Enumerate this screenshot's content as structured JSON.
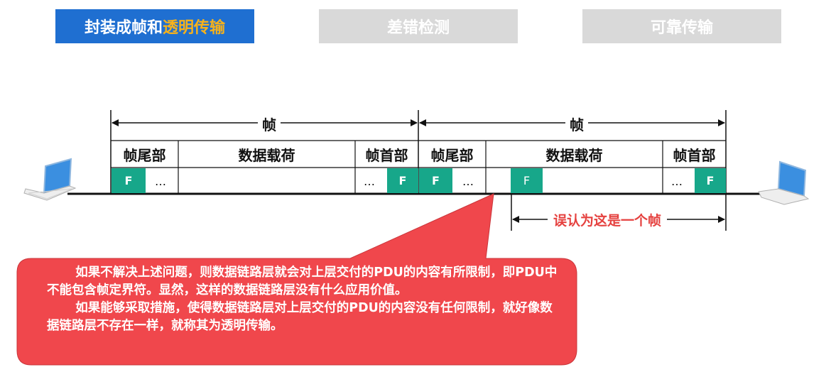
{
  "tabs": [
    {
      "label_a": "封装成帧和",
      "label_b": "透明传输",
      "active": true
    },
    {
      "label": "差错检测",
      "active": false
    },
    {
      "label": "可靠传输",
      "active": false
    }
  ],
  "diagram": {
    "frame_label": "帧",
    "header_label": "帧首部",
    "payload_label": "数据载荷",
    "trailer_label": "帧尾部",
    "flag": "F",
    "ellipsis": "…",
    "misread_label": "误认为这是一个帧"
  },
  "note": {
    "p1": "如果不解决上述问题，则数据链路层就会对上层交付的PDU的内容有所限制，即PDU中不能包含帧定界符。显然，这样的数据链路层没有什么应用价值。",
    "p2": "如果能够采取措施，使得数据链路层对上层交付的PDU的内容没有任何限制，就好像数据链路层不存在一样，就称其为透明传输。"
  },
  "colors": {
    "tab_active": "#1f6fd1",
    "tab_inactive": "#d9d9d9",
    "highlight": "#f7b21b",
    "flag": "#17a78a",
    "callout": "#f0474c",
    "misread": "#e5413f"
  }
}
